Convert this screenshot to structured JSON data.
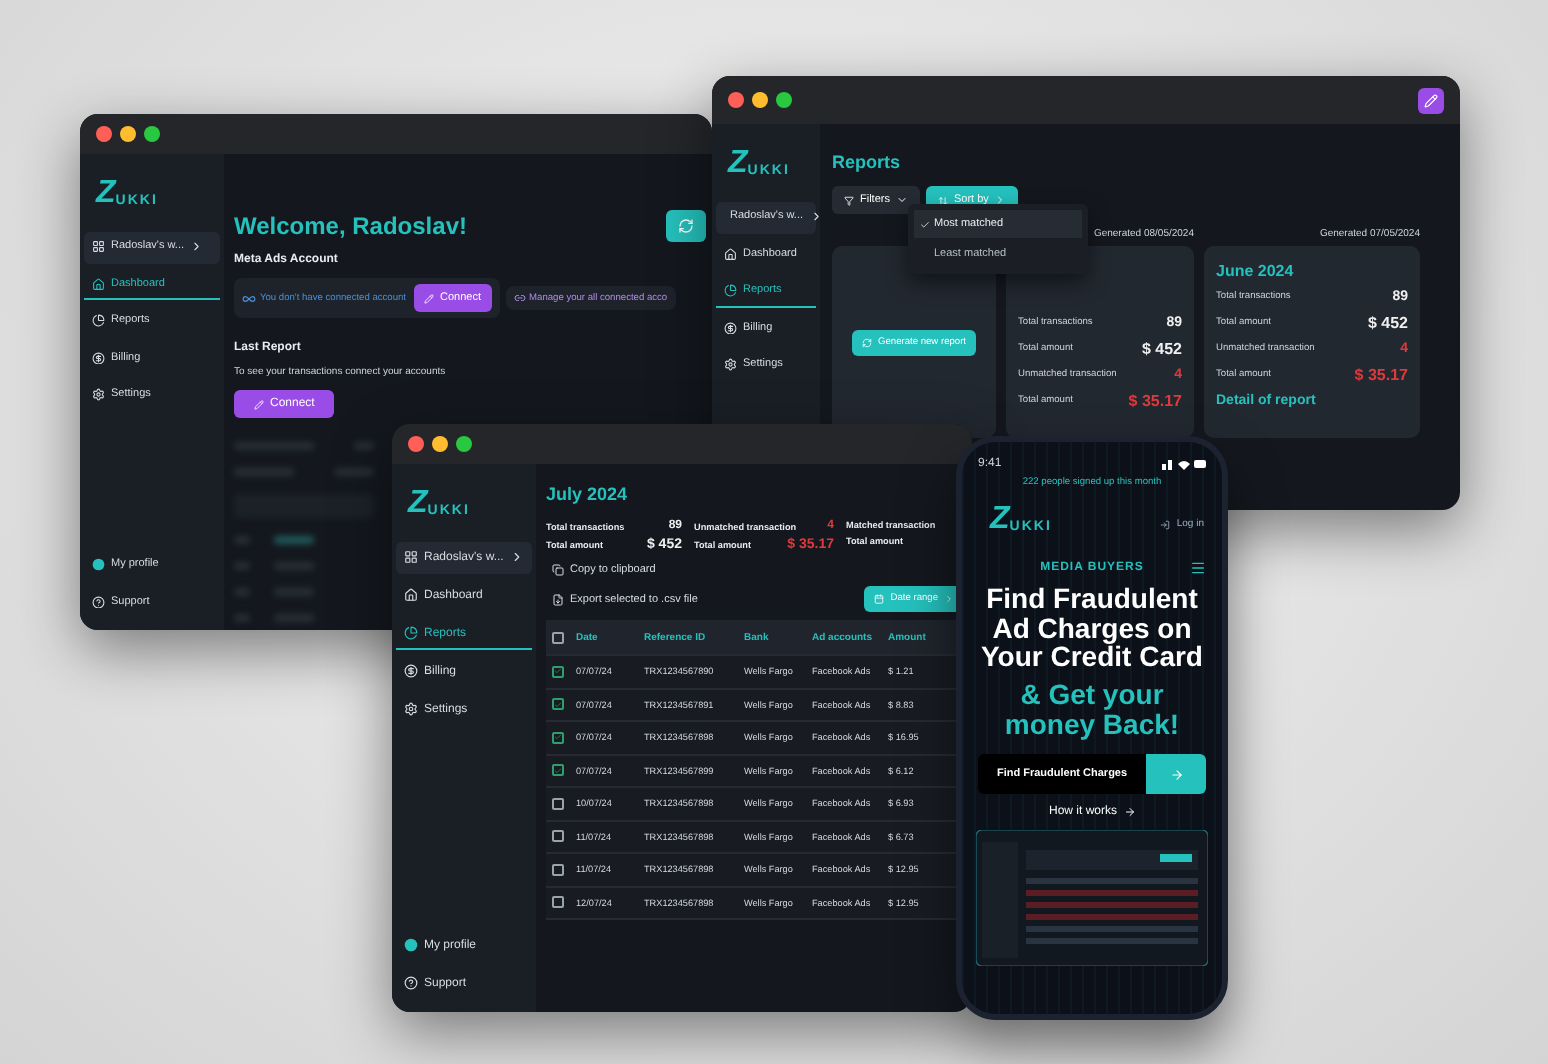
{
  "dashboard_window": {
    "logo": {
      "mark": "Z",
      "name": "UKKI"
    },
    "sidebar": {
      "items": [
        {
          "label": "Radoslav's w...",
          "kind": "workspace",
          "selected": false
        },
        {
          "label": "Dashboard",
          "kind": "home",
          "selected": true
        },
        {
          "label": "Reports",
          "kind": "reports",
          "selected": false
        },
        {
          "label": "Billing",
          "kind": "billing",
          "selected": false
        },
        {
          "label": "Settings",
          "kind": "settings",
          "selected": false
        }
      ],
      "footer": [
        {
          "label": "My profile",
          "kind": "profile"
        },
        {
          "label": "Support",
          "kind": "support"
        }
      ]
    },
    "heading": "Welcome, Radoslav!",
    "meta_section": {
      "title": "Meta Ads Account",
      "notice": "You don't have connected account",
      "button": "Connect",
      "manage_link": "Manage your all connected acco"
    },
    "last_report": {
      "title": "Last Report",
      "message": "To see your transactions connect your accounts",
      "button": "Connect"
    }
  },
  "reports_window": {
    "logo": {
      "mark": "Z",
      "name": "UKKI"
    },
    "sidebar": {
      "items": [
        {
          "label": "Radoslav's w...",
          "kind": "workspace",
          "selected": false
        },
        {
          "label": "Dashboard",
          "kind": "home",
          "selected": false
        },
        {
          "label": "Reports",
          "kind": "reports",
          "selected": true
        },
        {
          "label": "Billing",
          "kind": "billing",
          "selected": false
        },
        {
          "label": "Settings",
          "kind": "settings",
          "selected": false
        }
      ]
    },
    "heading": "Reports",
    "filters_button": "Filters",
    "sort_button": "Sort by",
    "sort_menu": [
      {
        "label": "Most matched",
        "selected": true
      },
      {
        "label": "Least matched",
        "selected": false
      }
    ],
    "generate_button": "Generate new report",
    "reports": [
      {
        "generated": "Generated 08/05/2024",
        "rows": [
          {
            "label": "Total transactions",
            "value": "89",
            "alert": false
          },
          {
            "label": "Total amount",
            "value": "$ 452",
            "alert": false
          },
          {
            "label": "Unmatched transaction",
            "value": "4",
            "alert": true
          },
          {
            "label": "Total amount",
            "value": "$ 35.17",
            "alert": true
          }
        ]
      },
      {
        "generated": "Generated 07/05/2024",
        "title": "June 2024",
        "rows": [
          {
            "label": "Total transactions",
            "value": "89",
            "alert": false
          },
          {
            "label": "Total amount",
            "value": "$ 452",
            "alert": false
          },
          {
            "label": "Unmatched transaction",
            "value": "4",
            "alert": true
          },
          {
            "label": "Total amount",
            "value": "$ 35.17",
            "alert": true
          }
        ],
        "link": "Detail of report"
      }
    ]
  },
  "report_window": {
    "logo": {
      "mark": "Z",
      "name": "UKKI"
    },
    "sidebar": {
      "items": [
        {
          "label": "Radoslav's w...",
          "kind": "workspace",
          "selected": false
        },
        {
          "label": "Dashboard",
          "kind": "home",
          "selected": false
        },
        {
          "label": "Reports",
          "kind": "reports",
          "selected": true
        },
        {
          "label": "Billing",
          "kind": "billing",
          "selected": false
        },
        {
          "label": "Settings",
          "kind": "settings",
          "selected": false
        }
      ],
      "footer": [
        {
          "label": "My profile",
          "kind": "profile"
        },
        {
          "label": "Support",
          "kind": "support"
        }
      ]
    },
    "heading": "July 2024",
    "stat_groups": [
      [
        {
          "label": "Total transactions",
          "value": "89",
          "alert": false
        },
        {
          "label": "Total amount",
          "value": "$ 452",
          "alert": false
        }
      ],
      [
        {
          "label": "Unmatched transaction",
          "value": "4",
          "alert": true
        },
        {
          "label": "Total amount",
          "value": "$ 35.17",
          "alert": true
        }
      ],
      [
        {
          "label": "Matched transaction"
        },
        {
          "label": "Total amount"
        }
      ]
    ],
    "actions": [
      "Copy to clipboard",
      "Export selected to .csv file"
    ],
    "date_button": "Date range",
    "table": {
      "select_all": false,
      "columns": [
        "Date",
        "Reference ID",
        "Bank",
        "Ad accounts",
        "Amount"
      ],
      "rows": [
        {
          "checked": true,
          "cells": [
            "07/07/24",
            "TRX1234567890",
            "Wells Fargo",
            "Facebook Ads",
            "$ 1.21"
          ]
        },
        {
          "checked": true,
          "cells": [
            "07/07/24",
            "TRX1234567891",
            "Wells Fargo",
            "Facebook Ads",
            "$ 8.83"
          ]
        },
        {
          "checked": true,
          "cells": [
            "07/07/24",
            "TRX1234567898",
            "Wells Fargo",
            "Facebook Ads",
            "$ 16.95"
          ]
        },
        {
          "checked": true,
          "cells": [
            "07/07/24",
            "TRX1234567899",
            "Wells Fargo",
            "Facebook Ads",
            "$ 6.12"
          ]
        },
        {
          "checked": false,
          "cells": [
            "10/07/24",
            "TRX1234567898",
            "Wells Fargo",
            "Facebook Ads",
            "$ 6.93"
          ]
        },
        {
          "checked": false,
          "cells": [
            "11/07/24",
            "TRX1234567898",
            "Wells Fargo",
            "Facebook Ads",
            "$ 6.73"
          ]
        },
        {
          "checked": false,
          "cells": [
            "11/07/24",
            "TRX1234567898",
            "Wells Fargo",
            "Facebook Ads",
            "$ 12.95"
          ]
        },
        {
          "checked": false,
          "cells": [
            "12/07/24",
            "TRX1234567898",
            "Wells Fargo",
            "Facebook Ads",
            "$ 12.95"
          ]
        }
      ]
    }
  },
  "phone": {
    "time": "9:41",
    "banner": "222 people signed up this month",
    "logo": {
      "mark": "Z",
      "name": "UKKI"
    },
    "login": "Log in",
    "eyebrow": "MEDIA BUYERS",
    "headline": "Find Fraudulent Ad Charges on Your Credit Card",
    "headline_accent": "& Get your money Back!",
    "cta": "Find Fraudulent Charges",
    "how_link": "How it works"
  }
}
